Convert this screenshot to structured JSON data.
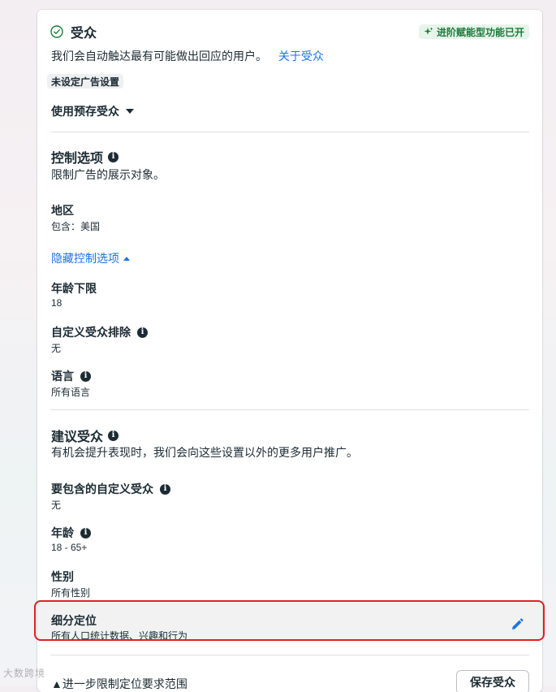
{
  "audience": {
    "title": "受众",
    "badge": "进阶赋能型功能已开",
    "description": "我们会自动触达最有可能做出回应的用户。",
    "about_link": "关于受众",
    "chip": "未设定广告设置",
    "preset_dropdown": "使用预存受众"
  },
  "controls": {
    "title": "控制选项",
    "subtitle": "限制广告的展示对象。",
    "location": {
      "label": "地区",
      "value": "包含：美国"
    },
    "hide_link": "隐藏控制选项",
    "min_age": {
      "label": "年龄下限",
      "value": "18"
    },
    "custom_exclusion": {
      "label": "自定义受众排除",
      "value": "无"
    },
    "language": {
      "label": "语言",
      "value": "所有语言"
    }
  },
  "suggestions": {
    "title": "建议受众",
    "subtitle": "有机会提升表现时，我们会向这些设置以外的更多用户推广。",
    "custom_include": {
      "label": "要包含的自定义受众",
      "value": "无"
    },
    "age": {
      "label": "年龄",
      "value": "18 - 65+"
    },
    "gender": {
      "label": "性别",
      "value": "所有性别"
    },
    "detailed_targeting": {
      "label": "细分定位",
      "value": "所有人口统计数据、兴趣和行为"
    }
  },
  "footer": {
    "text": "▲进一步限制定位要求范围",
    "save_button": "保存受众"
  },
  "watermark": "大数跨境",
  "colors": {
    "link": "#1b74e4",
    "badge_bg": "#e6f4ea",
    "badge_text": "#1e7a3b",
    "highlight_border": "#e0201f"
  }
}
